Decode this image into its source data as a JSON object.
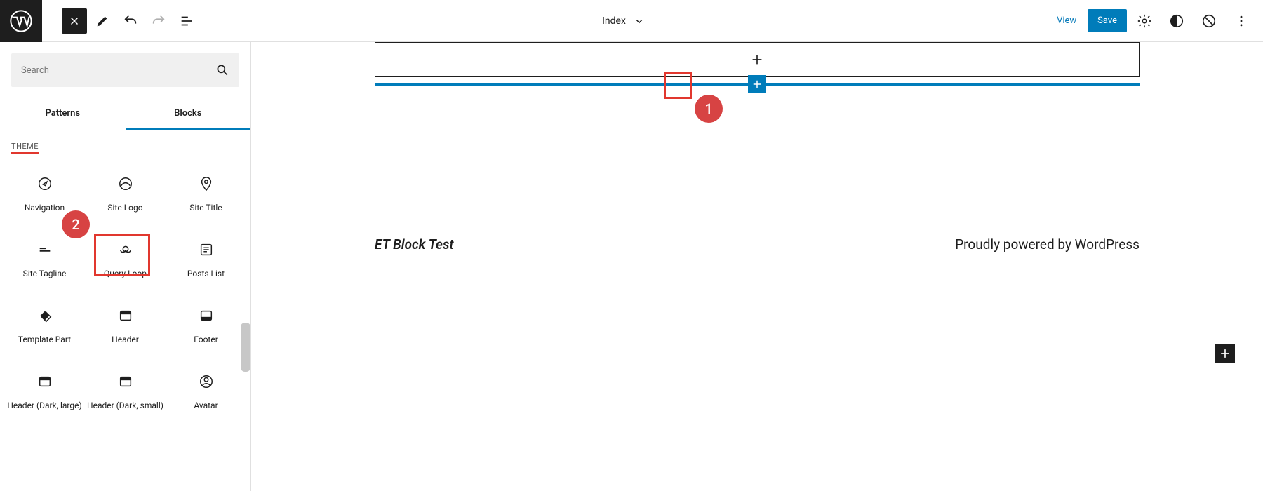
{
  "toolbar": {
    "template_name": "Index",
    "view": "View",
    "save": "Save"
  },
  "sidebar": {
    "search_placeholder": "Search",
    "tabs": {
      "patterns": "Patterns",
      "blocks": "Blocks"
    },
    "section": "THEME",
    "blocks": [
      {
        "id": "navigation",
        "label": "Navigation",
        "icon": "compass"
      },
      {
        "id": "site-logo",
        "label": "Site Logo",
        "icon": "circle-line"
      },
      {
        "id": "site-title",
        "label": "Site Title",
        "icon": "pin"
      },
      {
        "id": "site-tagline",
        "label": "Site Tagline",
        "icon": "tagline"
      },
      {
        "id": "query-loop",
        "label": "Query Loop",
        "icon": "loop"
      },
      {
        "id": "posts-list",
        "label": "Posts List",
        "icon": "list-box"
      },
      {
        "id": "template-part",
        "label": "Template Part",
        "icon": "diamond"
      },
      {
        "id": "header",
        "label": "Header",
        "icon": "header"
      },
      {
        "id": "footer",
        "label": "Footer",
        "icon": "footer"
      },
      {
        "id": "header-dark-large",
        "label": "Header (Dark, large)",
        "icon": "header"
      },
      {
        "id": "header-dark-small",
        "label": "Header (Dark, small)",
        "icon": "header"
      },
      {
        "id": "avatar",
        "label": "Avatar",
        "icon": "avatar"
      }
    ]
  },
  "canvas": {
    "site_title": "ET Block Test",
    "powered_prefix": "Proudly powered by ",
    "powered_link": "WordPress"
  },
  "annotations": {
    "one": "1",
    "two": "2"
  },
  "colors": {
    "accent": "#007cba",
    "annotation": "#e1372e"
  }
}
